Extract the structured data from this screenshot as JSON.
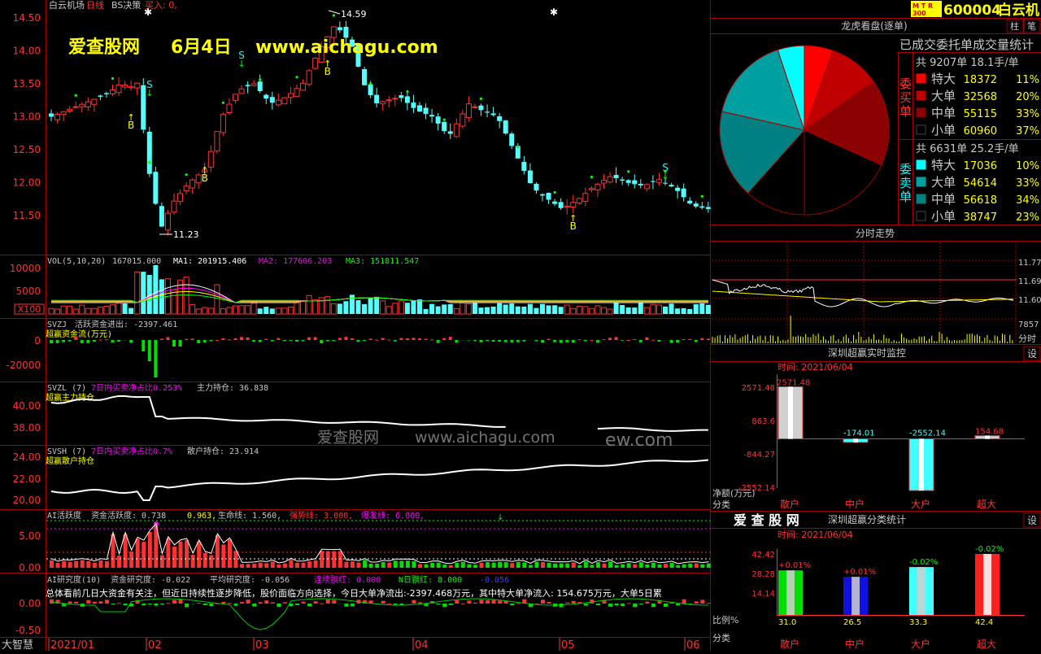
{
  "colors": {
    "up": "#ff3232",
    "down": "#54ffff",
    "frame": "#a00000",
    "axis_text": "#ff3232",
    "yellow": "#ffff00",
    "white": "#ffffff",
    "magenta": "#ff00ff",
    "green": "#00dd00",
    "buy_signal": "#ffff00"
  },
  "main_panel": {
    "stock_name": "白云机场",
    "period": "日线",
    "indicator": "BS决策",
    "buy_label": "买入: 0,",
    "watermark_site": "爱查股网",
    "watermark_date": "6月4日",
    "watermark_url": "www.aichagu.com",
    "y_ticks": [
      "14.50",
      "14.00",
      "13.50",
      "13.00",
      "12.50",
      "12.00",
      "11.50"
    ],
    "high_label": "14.59",
    "low_label": "11.23",
    "signals": [
      "B",
      "S",
      "B",
      "S",
      "B",
      "B",
      "S",
      "B"
    ]
  },
  "vol_panel": {
    "title": "VOL(5,10,20)",
    "vol_value": "167015.000",
    "ma1": "MA1: 201915.406",
    "ma2": "MA2: 177606.203",
    "ma3": "MA3: 151811.547",
    "y_ticks": [
      "10000",
      "5000"
    ],
    "unit": "X100"
  },
  "svzj_panel": {
    "title": "SVZJ",
    "line1": "活跃资金进出: -2397.461",
    "line2": "超赢资金流(万元)",
    "y_ticks": [
      "0",
      "-20000"
    ]
  },
  "svzl_panel": {
    "title": "SVZL (7)",
    "ratio": "7日内买卖净占比0.253%",
    "hold": "主力持仓: 36.838",
    "name": "超赢主力持仓",
    "y_ticks": [
      "40.00",
      "38.00"
    ]
  },
  "svsh_panel": {
    "title": "SVSH (7)",
    "ratio": "7日内买卖净占比0.7%",
    "hold": "散户持仓: 23.914",
    "name": "超赢散户持仓",
    "y_ticks": [
      "24.00",
      "22.00",
      "20.00"
    ]
  },
  "ai_panel": {
    "title": "AI活跃度",
    "active": "资金活跃度: 0.738",
    "v2": "0.963,",
    "life": "生命线: 1.560,",
    "strong": "强势线: 3.000,",
    "burst": "爆发线: 6.000,",
    "y_ticks": [
      "5.00",
      "0.00"
    ]
  },
  "research_panel": {
    "title": "AI研究度(10)",
    "res": "资金研究度: -0.022",
    "avg": "平均研究度: -0.056",
    "red": "连续飘红: 0.000",
    "n_red": "N日飘红: 8.000",
    "last": "-0.056",
    "summary": "总体看前几日大资金有关注，但近日持续性逐步降低，股价面临方向选择，今日大单净流出:-2397.468万元，其中特大单净流入: 154.675万元，大单5日累",
    "y_ticks": [
      "0.00",
      "-0.50"
    ]
  },
  "watermark_overlay": {
    "site": "爱查股网",
    "url": "www.aichagu.com",
    "tail": "ew.com"
  },
  "x_axis": {
    "left_label": "大智慧",
    "dates": [
      "2021/01",
      "02",
      "03",
      "04",
      "05",
      "06"
    ]
  },
  "stock_header": {
    "badge": "MTR 300",
    "code": "600004",
    "name": "白云机"
  },
  "dragon": {
    "title": "龙虎看盘(逐单)",
    "btn1": "柱",
    "btn2": "笔",
    "header": "已成交委托单成交量统计",
    "buy_side_label": "委买单",
    "sell_side_label": "委卖单",
    "buy_total": "共 9207单 18.1手/单",
    "sell_total": "共 6631单 25.2手/单",
    "buy_rows": [
      {
        "label": "特大",
        "value": "18372",
        "pct": "11%",
        "color": "#ff0000"
      },
      {
        "label": "大单",
        "value": "32568",
        "pct": "20%",
        "color": "#c00000"
      },
      {
        "label": "中单",
        "value": "55115",
        "pct": "33%",
        "color": "#8b0000"
      },
      {
        "label": "小单",
        "value": "60960",
        "pct": "37%",
        "color": "#000000"
      }
    ],
    "sell_rows": [
      {
        "label": "特大",
        "value": "17036",
        "pct": "10%",
        "color": "#00ffff"
      },
      {
        "label": "大单",
        "value": "54614",
        "pct": "33%",
        "color": "#00a0a0"
      },
      {
        "label": "中单",
        "value": "56618",
        "pct": "34%",
        "color": "#008080"
      },
      {
        "label": "小单",
        "value": "38747",
        "pct": "23%",
        "color": "#000000"
      }
    ]
  },
  "intraday": {
    "title": "分时走势",
    "y_ticks": [
      "11.77",
      "11.69",
      "11.60"
    ],
    "vol_label": "7857",
    "mode": "分时"
  },
  "realtime": {
    "title": "深圳超赢实时监控",
    "btn": "设",
    "time": "时间: 2021/06/04",
    "y_ticks": [
      "2571.48",
      "863.6",
      "-844.27",
      "-2552.14"
    ],
    "axis_label1": "净额(万元)",
    "axis_label2": "分类",
    "bars": [
      {
        "label": "散户",
        "value": "2571.48",
        "num": 2571.48
      },
      {
        "label": "中户",
        "value": "-174.01",
        "num": -174.01
      },
      {
        "label": "大户",
        "value": "-2552.14",
        "num": -2552.14
      },
      {
        "label": "超大",
        "value": "154.68",
        "num": 154.68
      }
    ]
  },
  "classify": {
    "logo": "爱 查 股 网",
    "title": "深圳超赢分类统计",
    "btn": "设",
    "time": "时间: 2021/06/04",
    "y_ticks": [
      "42.42",
      "28.28",
      "14.14"
    ],
    "axis_label1": "比例%",
    "axis_label2": "分类",
    "bars": [
      {
        "label": "散户",
        "value": "31.0",
        "num": 31.0,
        "delta": "+0.01%",
        "color": "#00dd00"
      },
      {
        "label": "中户",
        "value": "26.5",
        "num": 26.5,
        "delta": "+0.01%",
        "color": "#1010e0"
      },
      {
        "label": "大户",
        "value": "33.3",
        "num": 33.3,
        "delta": "-0.02%",
        "color": "#40ffff"
      },
      {
        "label": "超大",
        "value": "42.4",
        "num": 42.4,
        "delta": "-0.02%",
        "color": "#ff2020"
      }
    ]
  }
}
